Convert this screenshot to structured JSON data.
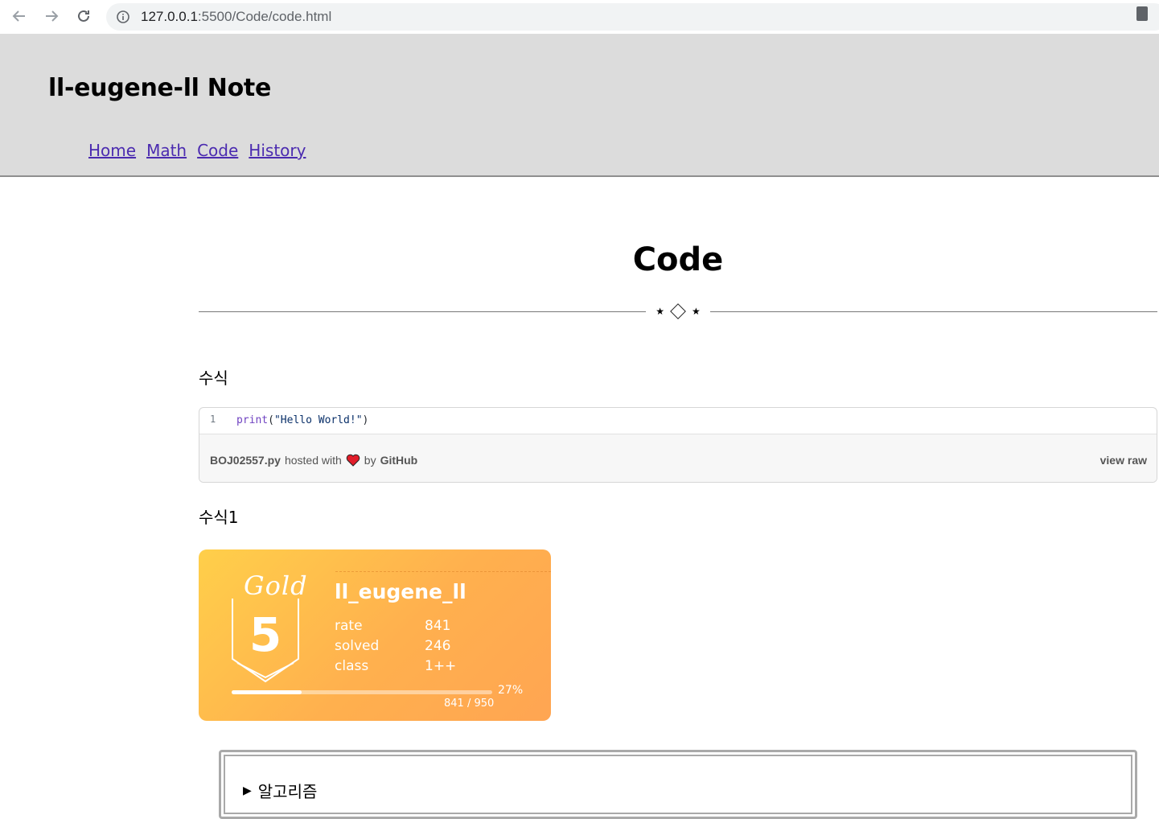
{
  "browser": {
    "url_host": "127.0.0.1",
    "url_path": ":5500/Code/code.html"
  },
  "header": {
    "title": "ll-eugene-ll Note",
    "nav": [
      {
        "label": "Home"
      },
      {
        "label": "Math"
      },
      {
        "label": "Code"
      },
      {
        "label": "History"
      }
    ]
  },
  "main": {
    "page_title": "Code",
    "divider_ornament": "⋆ ◇ ⋆",
    "section1_label": "수식",
    "gist": {
      "line_number": "1",
      "code_fn": "print",
      "code_open": "(",
      "code_str": "\"Hello World!\"",
      "code_close": ")",
      "filename": "BOJ02557.py",
      "hosted_with": "hosted with",
      "by": "by",
      "host": "GitHub",
      "view_raw": "view raw"
    },
    "section2_label": "수식1",
    "badge": {
      "tier": "Gold",
      "tier_level": "5",
      "handle": "ll_eugene_ll",
      "stats": [
        {
          "key": "rate",
          "value": "841"
        },
        {
          "key": "solved",
          "value": "246"
        },
        {
          "key": "class",
          "value": "1++"
        }
      ],
      "progress_fraction": 0.27,
      "progress_pct": "27%",
      "progress_count": "841 / 950",
      "colors": {
        "gradient_start": "#ffcf4a",
        "gradient_end": "#ffa552"
      }
    },
    "details": {
      "summary_marker": "▶",
      "summary_label": "알고리즘"
    }
  }
}
